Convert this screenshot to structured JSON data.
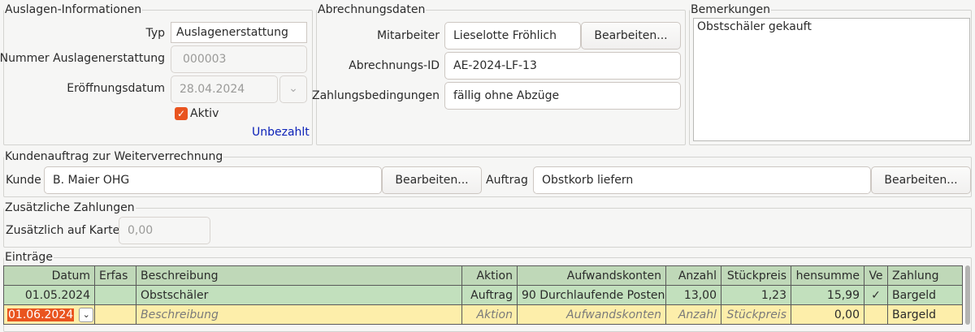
{
  "expense_info": {
    "legend": "Auslagen-Informationen",
    "type_label": "Typ",
    "type_value": "Auslagenerstattung",
    "number_label": "Nummer Auslagenerstattung",
    "number_value": "000003",
    "date_label": "Eröffnungsdatum",
    "date_value": "28.04.2024",
    "active_label": "Aktiv",
    "status_link": "Unbezahlt"
  },
  "billing": {
    "legend": "Abrechnungsdaten",
    "employee_label": "Mitarbeiter",
    "employee_value": "Lieselotte Fröhlich",
    "edit_label": "Bearbeiten...",
    "billing_id_label": "Abrechnungs-ID",
    "billing_id_value": "AE-2024-LF-13",
    "terms_label": "Zahlungsbedingungen",
    "terms_value": "fällig ohne Abzüge"
  },
  "remarks": {
    "legend": "Bemerkungen",
    "text": "Obstschäler gekauft"
  },
  "customer_order": {
    "legend": "Kundenauftrag zur Weiterverrechnung",
    "customer_label": "Kunde",
    "customer_value": "B. Maier OHG",
    "customer_edit": "Bearbeiten...",
    "order_label": "Auftrag",
    "order_value": "Obstkorb liefern",
    "order_edit": "Bearbeiten..."
  },
  "additional_payments": {
    "legend": "Zusätzliche Zahlungen",
    "card_label": "Zusätzlich auf Karte",
    "card_placeholder": "0,00"
  },
  "entries": {
    "legend": "Einträge",
    "columns": [
      "Datum",
      "Erfas",
      "Beschreibung",
      "Aktion",
      "Aufwandskonten",
      "Anzahl",
      "Stückpreis",
      "hensumme",
      "Ve",
      "Zahlung"
    ],
    "row1": {
      "date": "01.05.2024",
      "captured": "",
      "description": "Obstschäler",
      "action": "Auftrag",
      "account": "90 Durchlaufende Posten",
      "quantity": "13,00",
      "unit_price": "1,23",
      "total": "15,99",
      "checked": "✓",
      "payment": "Bargeld"
    },
    "row2": {
      "date": "01.06.2024",
      "captured": "",
      "description": "Beschreibung",
      "action": "Aktion",
      "account": "Aufwandskonten",
      "quantity": "Anzahl",
      "unit_price": "Stückpreis",
      "total": "0,00",
      "checked": "",
      "payment": "Bargeld"
    }
  },
  "icons": {
    "checkbox": "✓",
    "dropdown": "⌄"
  },
  "colors": {
    "accent": "#e9541f",
    "link": "#0b21b8",
    "row_saved": "#c2e0bd",
    "row_new": "#fdeeaa",
    "header": "#bfd8b8"
  }
}
